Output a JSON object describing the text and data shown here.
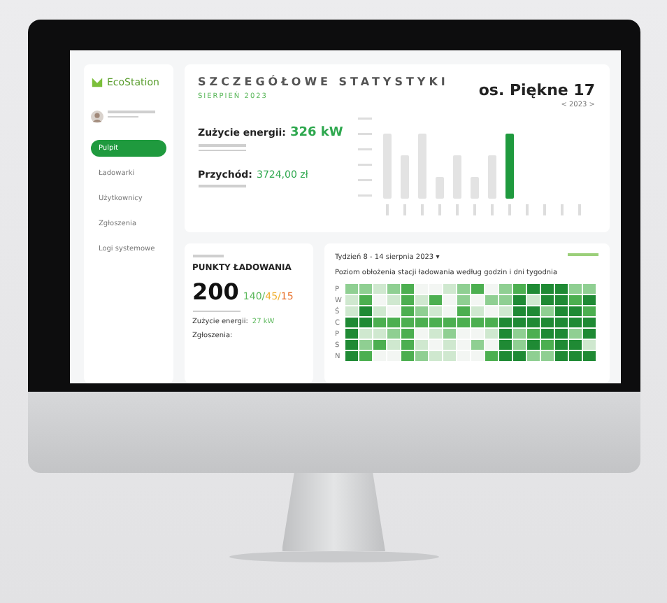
{
  "sidebar": {
    "logo": "EcoStation",
    "items": [
      {
        "label": "Pulpit",
        "selected": true
      },
      {
        "label": "Ładowarki",
        "selected": false
      },
      {
        "label": "Użytkownicy",
        "selected": false
      },
      {
        "label": "Zgłoszenia",
        "selected": false
      },
      {
        "label": "Logi systemowe",
        "selected": false
      }
    ]
  },
  "stats": {
    "title": "SZCZEGÓŁOWE STATYSTYKI",
    "period": "SIERPIEŃ 2023",
    "location": "os. Piękne 17",
    "year_picker": "< 2023 >",
    "energy_label": "Zużycie energii:",
    "energy_value": "326 kW",
    "revenue_label": "Przychód:",
    "revenue_value": "3724,00 zł"
  },
  "points": {
    "title": "PUNKTY ŁADOWANIA",
    "total": "200",
    "counts": [
      {
        "value": "140/",
        "color": "#5cb85c"
      },
      {
        "value": "45/",
        "color": "#f0b030"
      },
      {
        "value": "15",
        "color": "#e8702a"
      }
    ],
    "energy_label": "Zużycie energii:",
    "energy_value": "27 kW",
    "reports_label": "Zgłoszenia:"
  },
  "heatmap": {
    "week": "Tydzień 8 - 14 sierpnia 2023 ▾",
    "caption": "Poziom obłożenia stacji ładowania według godzin i dni tygodnia",
    "days": [
      "P",
      "W",
      "Ś",
      "C",
      "P",
      "S",
      "N"
    ]
  }
}
